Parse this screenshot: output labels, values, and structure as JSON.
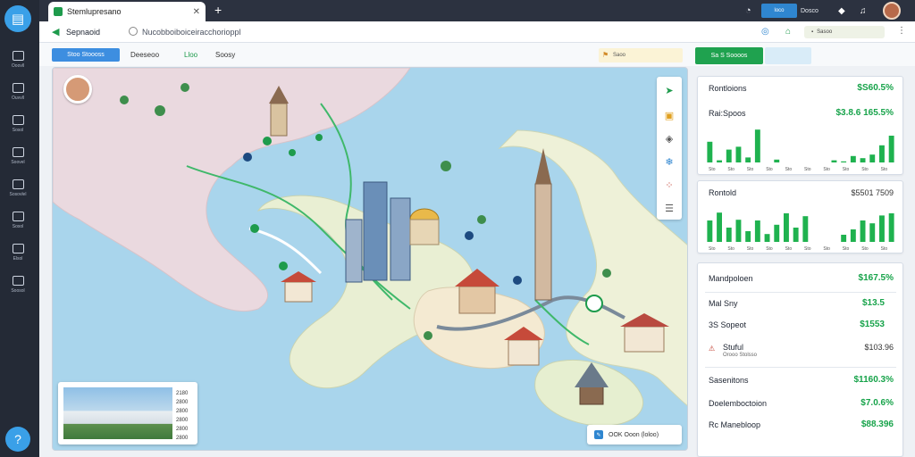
{
  "rail": {
    "items": [
      {
        "icon": "grid-icon",
        "label": "Ooovll"
      },
      {
        "icon": "document-icon",
        "label": "Ouvvll"
      },
      {
        "icon": "book-icon",
        "label": "Sosol"
      },
      {
        "icon": "car-icon",
        "label": "Soovel"
      },
      {
        "icon": "link-icon",
        "label": "Sosovlel"
      },
      {
        "icon": "route-icon",
        "label": "Sosol"
      },
      {
        "icon": "edit-icon",
        "label": "Elsol"
      },
      {
        "icon": "stack-icon",
        "label": "Soosol"
      }
    ]
  },
  "browser": {
    "tab_title": "Stemlupresano",
    "status_text": "Dosco",
    "blue_pill": "loco"
  },
  "address": {
    "site_name": "Sepnaoid",
    "url": "Nucobboiboiceiracchorioppl",
    "pill_text": "Sasoo"
  },
  "toolbar": {
    "filter_label": "Stoo Stoooss",
    "crumbs": [
      "Deeseoo",
      "Lloo",
      "Soosy"
    ],
    "search_text": "Saoo",
    "green_button": "Sa S Soooos"
  },
  "map": {
    "thumb_numbers": [
      "2180",
      "2800",
      "2800",
      "2800",
      "2800",
      "2800"
    ],
    "legend_text": "OOK Ooon (loloo)"
  },
  "panel": {
    "card1": {
      "row1_label": "Rontloions",
      "row1_value": "$S60.5%",
      "row2_label": "Rai:Spoos",
      "row2_value": "$3.8.6 165.5%",
      "tick_labels": [
        "Sto",
        "Sto",
        "Sto",
        "Sto",
        "Sto",
        "Sto",
        "Sto",
        "Sto",
        "Sto",
        "Sto"
      ]
    },
    "card2": {
      "row1_label": "Rontold",
      "row1_value": "$5501 7509",
      "tick_labels": [
        "Sto",
        "Sto",
        "Sto",
        "Sto",
        "Sto",
        "Sto",
        "Sto",
        "Sto",
        "Sto",
        "Sto"
      ]
    },
    "card3": {
      "rows": [
        {
          "label": "Mandpoloen",
          "value": "$167.5%"
        },
        {
          "label": "Mal Sny",
          "value": "$13.5"
        },
        {
          "label": "3S Sopeot",
          "value": "$1553"
        },
        {
          "label": "Stuful",
          "value": "$103.96"
        },
        {
          "label": "Sasenitons",
          "value": "$1160.3%"
        },
        {
          "label": "Doelemboctoion",
          "value": "$7.0.6%"
        },
        {
          "label": "Rc Manebloop",
          "value": "$88.396"
        }
      ],
      "sub_label": "Orooo Stolsso"
    }
  },
  "chart_data": [
    {
      "type": "bar",
      "categories": [
        "1",
        "2",
        "3",
        "4",
        "5",
        "6",
        "7",
        "8",
        "9",
        "10",
        "11",
        "12",
        "13",
        "14",
        "15",
        "16",
        "17",
        "18",
        "19",
        "20"
      ],
      "values": [
        58,
        6,
        36,
        44,
        14,
        92,
        0,
        8,
        0,
        0,
        0,
        0,
        0,
        6,
        3,
        18,
        12,
        22,
        48,
        75
      ],
      "ylim": [
        0,
        100
      ]
    },
    {
      "type": "bar",
      "categories": [
        "1",
        "2",
        "3",
        "4",
        "5",
        "6",
        "7",
        "8",
        "9",
        "10",
        "11",
        "12",
        "13",
        "14",
        "15",
        "16",
        "17",
        "18",
        "19",
        "20"
      ],
      "values": [
        60,
        82,
        40,
        62,
        30,
        60,
        22,
        48,
        80,
        40,
        72,
        0,
        0,
        0,
        20,
        35,
        60,
        52,
        74,
        80
      ],
      "ylim": [
        0,
        100
      ]
    }
  ]
}
